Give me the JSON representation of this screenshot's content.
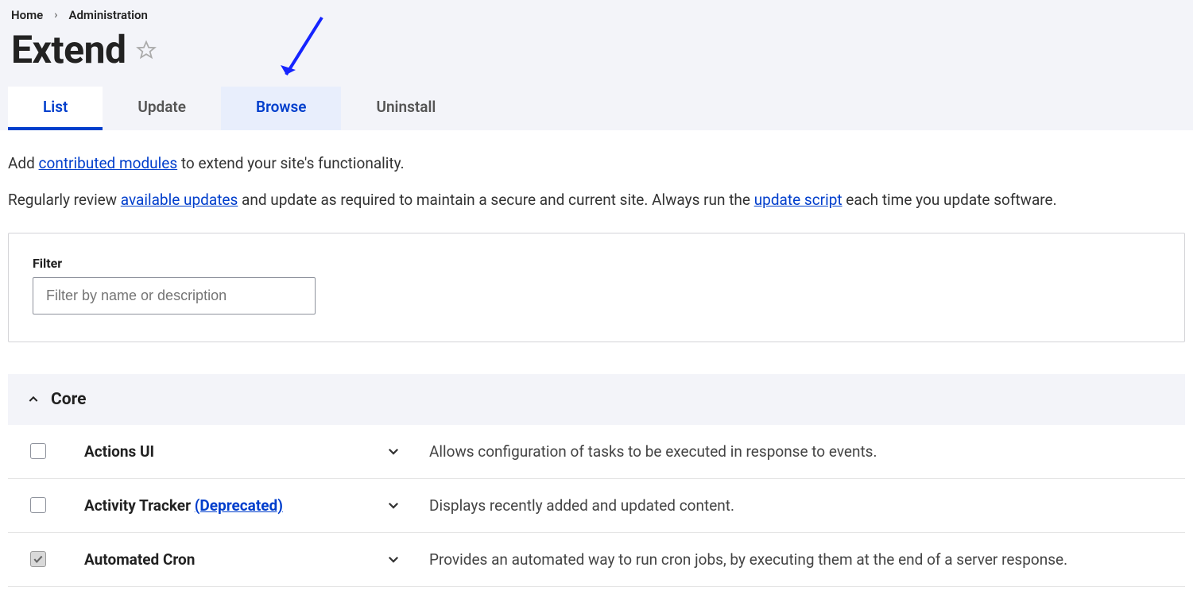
{
  "breadcrumb": {
    "home": "Home",
    "admin": "Administration"
  },
  "page_title": "Extend",
  "tabs": {
    "list": "List",
    "update": "Update",
    "browse": "Browse",
    "uninstall": "Uninstall"
  },
  "intro": {
    "line1_pre": "Add ",
    "line1_link": "contributed modules",
    "line1_post": " to extend your site's functionality.",
    "line2_pre": "Regularly review ",
    "line2_link1": "available updates",
    "line2_mid": " and update as required to maintain a secure and current site. Always run the ",
    "line2_link2": "update script",
    "line2_post": " each time you update software."
  },
  "filter": {
    "label": "Filter",
    "placeholder": "Filter by name or description"
  },
  "group": {
    "core": "Core"
  },
  "modules": [
    {
      "name": "Actions UI",
      "deprecated": "",
      "desc": "Allows configuration of tasks to be executed in response to events.",
      "checked": false
    },
    {
      "name": "Activity Tracker ",
      "deprecated": "(Deprecated)",
      "desc": "Displays recently added and updated content.",
      "checked": false
    },
    {
      "name": "Automated Cron",
      "deprecated": "",
      "desc": "Provides an automated way to run cron jobs, by executing them at the end of a server response.",
      "checked": true
    }
  ]
}
